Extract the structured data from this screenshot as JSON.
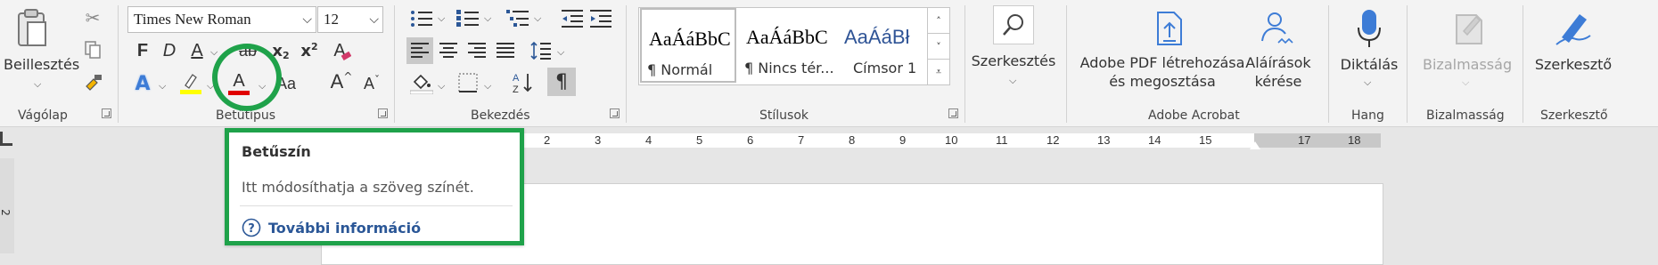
{
  "ribbon": {
    "clipboard": {
      "paste_label": "Beillesztés",
      "group_label": "Vágólap"
    },
    "font": {
      "font_name": "Times New Roman",
      "font_size": "12",
      "bold": "F",
      "italic": "D",
      "underline": "A",
      "strike": "ab",
      "subscript": "x",
      "subscript_digit": "2",
      "superscript": "x",
      "superscript_digit": "2",
      "clear_format": "A",
      "text_effects": "A",
      "font_color": "A",
      "change_case": "Aa",
      "grow": "A",
      "shrink": "A",
      "group_label": "Betűtípus",
      "highlight_color": "#ffff00",
      "font_color_value": "#e00000"
    },
    "paragraph": {
      "group_label": "Bekezdés",
      "pilcrow": "¶"
    },
    "styles": {
      "items": [
        {
          "preview": "AaÁáBbC",
          "name": "¶ Normál"
        },
        {
          "preview": "AaÁáBbC",
          "name": "¶ Nincs tér..."
        },
        {
          "preview": "AaÁáBł",
          "name": "Címsor 1"
        }
      ],
      "group_label": "Stílusok"
    },
    "editing": {
      "label": "Szerkesztés"
    },
    "acrobat": {
      "pdf_label_line1": "Adobe PDF létrehozása",
      "pdf_label_line2": "és megosztása",
      "sign_label_line1": "Aláírások",
      "sign_label_line2": "kérése",
      "group_label": "Adobe Acrobat"
    },
    "voice": {
      "dictate_label": "Diktálás",
      "group_label": "Hang"
    },
    "sensitivity": {
      "label": "Bizalmasság",
      "group_label": "Bizalmasság"
    },
    "editor": {
      "label": "Szerkesztő",
      "group_label": "Szerkesztő"
    }
  },
  "ruler": {
    "ticks": [
      "2",
      "3",
      "4",
      "5",
      "6",
      "7",
      "8",
      "9",
      "10",
      "11",
      "12",
      "13",
      "14",
      "15",
      "17",
      "18"
    ],
    "left_marks": [
      "2"
    ]
  },
  "tooltip": {
    "title": "Betűszín",
    "description": "Itt módosíthatja a szöveg színét.",
    "link": "További információ"
  }
}
